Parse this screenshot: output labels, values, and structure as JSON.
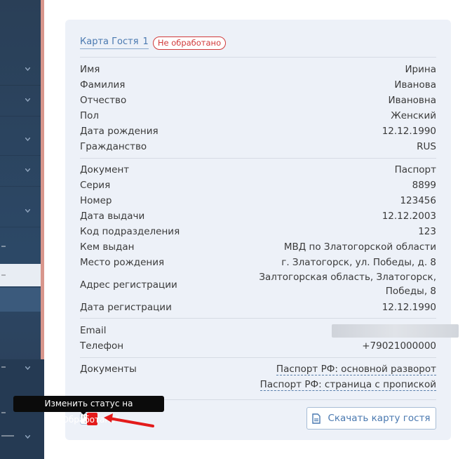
{
  "card": {
    "title": "Карта Гостя",
    "number": "1",
    "status": "Не обработано",
    "personal": [
      {
        "label": "Имя",
        "value": "Ирина"
      },
      {
        "label": "Фамилия",
        "value": "Иванова"
      },
      {
        "label": "Отчество",
        "value": "Ивановна"
      },
      {
        "label": "Пол",
        "value": "Женский"
      },
      {
        "label": "Дата рождения",
        "value": "12.12.1990"
      },
      {
        "label": "Гражданство",
        "value": "RUS"
      }
    ],
    "document": [
      {
        "label": "Документ",
        "value": "Паспорт"
      },
      {
        "label": "Серия",
        "value": "8899"
      },
      {
        "label": "Номер",
        "value": "123456"
      },
      {
        "label": "Дата выдачи",
        "value": "12.12.2003"
      },
      {
        "label": "Код подразделения",
        "value": "123"
      },
      {
        "label": "Кем выдан",
        "value": "МВД по Златогорской области"
      },
      {
        "label": "Место рождения",
        "value": "г. Златогорск, ул. Победы, д. 8"
      },
      {
        "label": "Адрес регистрации",
        "value": "Залтогорская область, Златогорск, Победы, 8"
      },
      {
        "label": "Дата регистрации",
        "value": "12.12.1990"
      }
    ],
    "contacts": [
      {
        "label": "Email",
        "value": ""
      },
      {
        "label": "Телефон",
        "value": "+79021000000"
      }
    ],
    "documents_label": "Документы",
    "documents": [
      "Паспорт РФ: основной разворот",
      "Паспорт РФ: страница с пропиской"
    ],
    "download_label": "Скачать карту гостя"
  },
  "tooltip": "Изменить статус на \"Обработано\"",
  "colors": {
    "accent": "#4a79b0",
    "status_red": "#d13a3a",
    "annotation_red": "#e31b1b"
  }
}
